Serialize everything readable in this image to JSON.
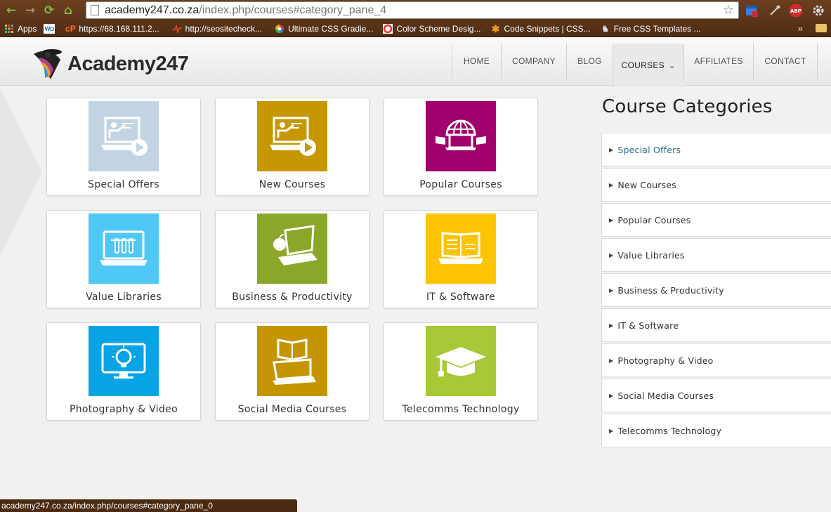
{
  "browser": {
    "url_host": "academy247.co.za",
    "url_path": "/index.php/courses#category_pane_4",
    "bookmarks": [
      {
        "label": "Apps",
        "icon": "apps-grid-icon",
        "color": "#e8b34a"
      },
      {
        "label": "",
        "icon": "wd-icon",
        "color": "#2b6cb0"
      },
      {
        "label": "https://68.168.111.2...",
        "icon": "cpanel-icon",
        "color": "#ff6c2c"
      },
      {
        "label": "http://seositecheck...",
        "icon": "pulse-icon",
        "color": "#e2452f"
      },
      {
        "label": "Ultimate CSS Gradie...",
        "icon": "color-wheel-icon",
        "color": "#b44ad8"
      },
      {
        "label": "Color Scheme Desig...",
        "icon": "color-scheme-icon",
        "color": "#e8322f"
      },
      {
        "label": "Code Snippets | CSS...",
        "icon": "snippets-icon",
        "color": "#f39a1c"
      },
      {
        "label": "Free CSS Templates ...",
        "icon": "templates-icon",
        "color": "#cccccc"
      }
    ],
    "more": "»",
    "status_url": "academy247.co.za/index.php/courses#category_pane_0"
  },
  "site": {
    "logo_text": "Academy247",
    "menu": [
      {
        "label": "HOME",
        "name": "nav-home"
      },
      {
        "label": "COMPANY",
        "name": "nav-company"
      },
      {
        "label": "BLOG",
        "name": "nav-blog"
      },
      {
        "label": "COURSES",
        "name": "nav-courses",
        "active": true
      },
      {
        "label": "AFFILIATES",
        "name": "nav-affiliates"
      },
      {
        "label": "CONTACT",
        "name": "nav-contact"
      }
    ]
  },
  "cards": [
    {
      "label": "Special Offers",
      "color": "#c2d4e3",
      "icon": "presenter-laptop-play-icon"
    },
    {
      "label": "New Courses",
      "color": "#c79700",
      "icon": "presenter-laptop-play-icon"
    },
    {
      "label": "Popular Courses",
      "color": "#a0006b",
      "icon": "globe-laptops-icon"
    },
    {
      "label": "Value Libraries",
      "color": "#4fc8f5",
      "icon": "test-tubes-laptop-icon"
    },
    {
      "label": "Business & Productivity",
      "color": "#8aa72a",
      "icon": "apple-laptop-icon"
    },
    {
      "label": "IT & Software",
      "color": "#fcc405",
      "icon": "book-laptop-icon"
    },
    {
      "label": "Photography & Video",
      "color": "#06a4e5",
      "icon": "lightbulb-monitor-icon"
    },
    {
      "label": "Social Media Courses",
      "color": "#c49500",
      "icon": "book-laptop-open-icon"
    },
    {
      "label": "Telecomms Technology",
      "color": "#a8c935",
      "icon": "graduation-cap-icon"
    }
  ],
  "sidebar": {
    "title": "Course Categories",
    "items": [
      "Special Offers",
      "New Courses",
      "Popular Courses",
      "Value Libraries",
      "Business & Productivity",
      "IT & Software",
      "Photography & Video",
      "Social Media Courses",
      "Telecomms Technology"
    ]
  }
}
